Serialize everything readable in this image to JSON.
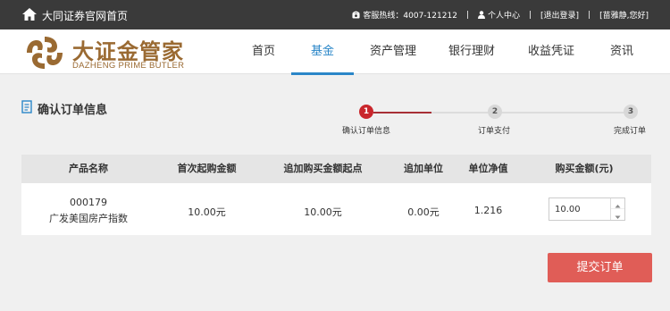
{
  "topbar": {
    "home_label": "大同证券官网首页",
    "hotline": "客服热线：4007-121212",
    "user_center": "个人中心",
    "logout": "[退出登录]",
    "greeting": "[苗雅静,您好]"
  },
  "header": {
    "logo_cn": "大证金管家",
    "logo_en": "DAZHENG PRIME BUTLER",
    "brand_color": "#9a6a32",
    "nav": [
      {
        "label": "首页",
        "active": false
      },
      {
        "label": "基金",
        "active": true
      },
      {
        "label": "资产管理",
        "active": false
      },
      {
        "label": "银行理财",
        "active": false
      },
      {
        "label": "收益凭证",
        "active": false
      },
      {
        "label": "资讯",
        "active": false
      }
    ],
    "accent_color": "#2a86c8"
  },
  "section": {
    "title": "确认订单信息"
  },
  "steps": [
    {
      "num": "1",
      "label": "确认订单信息",
      "state": "active"
    },
    {
      "num": "2",
      "label": "订单支付",
      "state": "pending"
    },
    {
      "num": "3",
      "label": "完成订单",
      "state": "pending"
    }
  ],
  "table": {
    "headers": [
      "产品名称",
      "首次起购金额",
      "追加购买金额起点",
      "追加单位",
      "单位净值",
      "购买金额(元)"
    ],
    "row": {
      "code": "000179",
      "name": "广发美国房产指数",
      "first_min": "10.00元",
      "add_min": "10.00元",
      "add_unit": "0.00元",
      "nav": "1.216",
      "amount": "10.00"
    }
  },
  "submit_label": "提交订单",
  "colors": {
    "topbar_bg": "#3a3a3a",
    "step_active": "#c9262c",
    "step_pending": "#d8d8d8",
    "submit_bg": "#e05d57"
  }
}
